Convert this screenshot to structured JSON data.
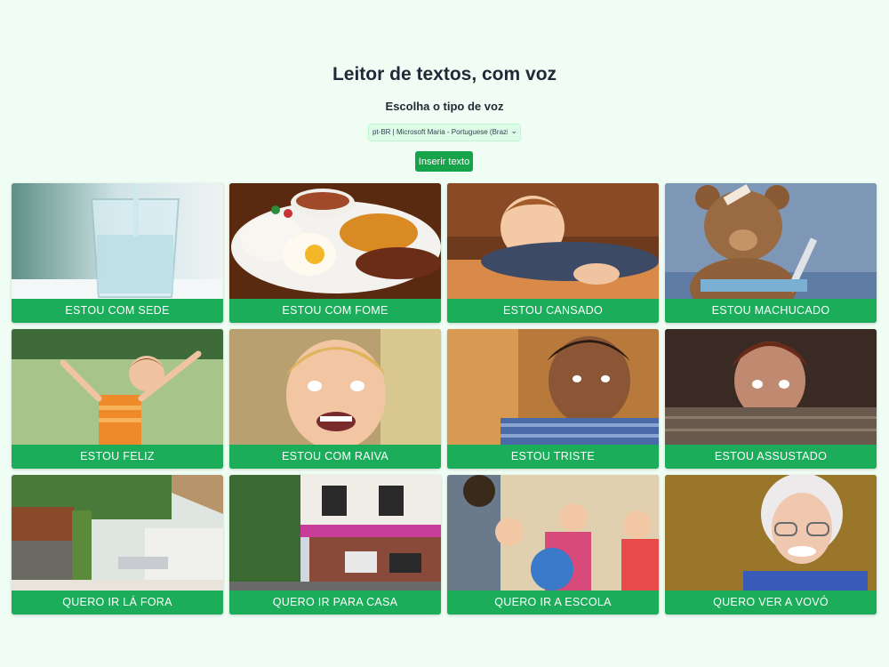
{
  "header": {
    "title": "Leitor de textos, com voz",
    "subtitle": "Escolha o tipo de voz"
  },
  "voice_select": {
    "selected": "pt-BR | Microsoft Maria - Portuguese (Brazil)",
    "icon": "chevron-down-icon"
  },
  "insert_button": {
    "label": "Inserir texto"
  },
  "colors": {
    "page_background": "#f0fdf4",
    "accent_green": "#16a34a",
    "card_label_green": "#1cad5a",
    "label_text": "#ffffff"
  },
  "cards": [
    {
      "label": "ESTOU COM SEDE",
      "image": "glass-of-water-image"
    },
    {
      "label": "ESTOU COM FOME",
      "image": "plate-of-food-image"
    },
    {
      "label": "ESTOU CANSADO",
      "image": "tired-child-image"
    },
    {
      "label": "ESTOU MACHUCADO",
      "image": "injured-teddy-bear-image"
    },
    {
      "label": "ESTOU FELIZ",
      "image": "happy-child-image"
    },
    {
      "label": "ESTOU COM RAIVA",
      "image": "angry-child-image"
    },
    {
      "label": "ESTOU TRISTE",
      "image": "sad-child-image"
    },
    {
      "label": "ESTOU ASSUSTADO",
      "image": "scared-child-image"
    },
    {
      "label": "QUERO IR LÁ FORA",
      "image": "garden-image"
    },
    {
      "label": "QUERO IR PARA CASA",
      "image": "house-image"
    },
    {
      "label": "QUERO IR A ESCOLA",
      "image": "classroom-image"
    },
    {
      "label": "QUERO VER A VOVÓ",
      "image": "grandmother-image"
    }
  ]
}
